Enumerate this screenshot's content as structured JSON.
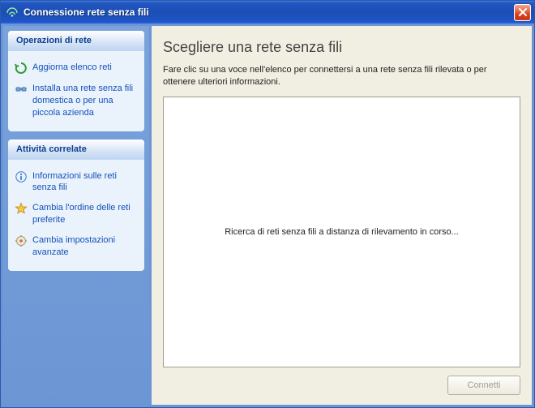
{
  "window": {
    "title": "Connessione rete senza fili"
  },
  "sidebar": {
    "sections": [
      {
        "header": "Operazioni di rete",
        "items": [
          {
            "label": "Aggiorna elenco reti",
            "icon": "refresh"
          },
          {
            "label": "Installa una rete senza fili domestica o per una piccola azienda",
            "icon": "setup"
          }
        ]
      },
      {
        "header": "Attività correlate",
        "items": [
          {
            "label": "Informazioni sulle reti senza fili",
            "icon": "info"
          },
          {
            "label": "Cambia l'ordine delle reti preferite",
            "icon": "star"
          },
          {
            "label": "Cambia impostazioni avanzate",
            "icon": "settings"
          }
        ]
      }
    ]
  },
  "main": {
    "heading": "Scegliere una rete senza fili",
    "subtext": "Fare clic su una voce nell'elenco per connettersi a una rete senza fili rilevata o per ottenere ulteriori informazioni.",
    "status": "Ricerca di reti senza fili a distanza di rilevamento in corso...",
    "connect_button": "Connetti"
  }
}
